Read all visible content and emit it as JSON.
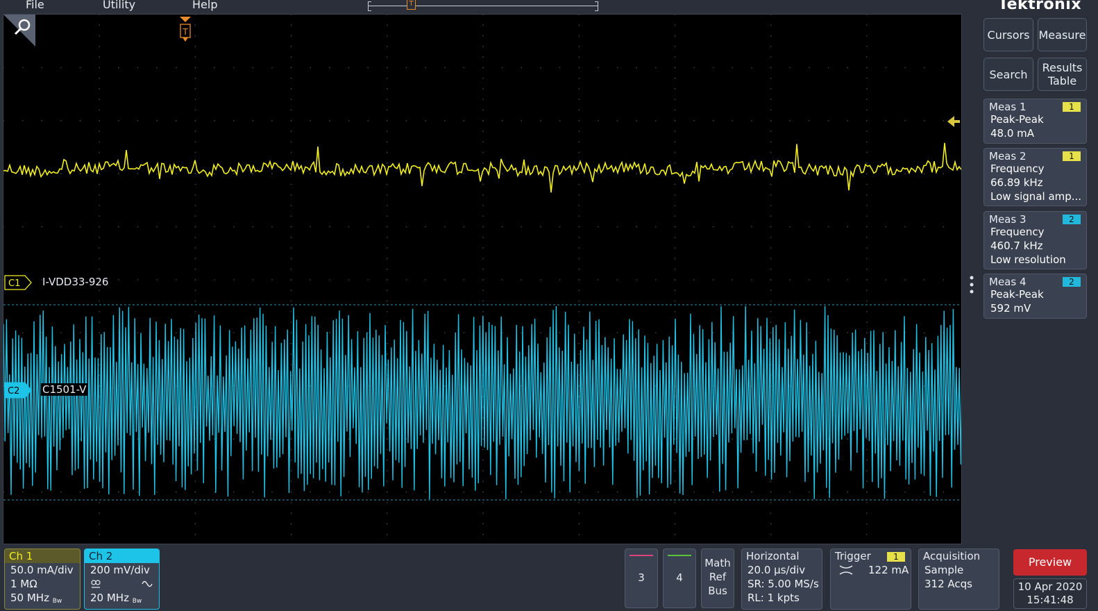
{
  "menu": {
    "file": "File",
    "utility": "Utility",
    "help": "Help"
  },
  "brand": "Tektronix",
  "timeline": {
    "trigger_glyph": "T"
  },
  "display": {
    "trigger_glyph": "T",
    "ch1_tag": "C1",
    "ch1_name": "I-VDD33-926",
    "ch2_tag": "C2",
    "ch2_name": "C1501-V",
    "ch1_color": "#f2ee22",
    "ch2_color": "#1ec4e8"
  },
  "side_buttons": {
    "cursors": "Cursors",
    "measure": "Measure",
    "search": "Search",
    "results_table": [
      "Results",
      "Table"
    ]
  },
  "measurements": [
    {
      "title": "Meas 1",
      "badge": "1",
      "lines": [
        "Peak-Peak",
        "48.0 mA"
      ]
    },
    {
      "title": "Meas 2",
      "badge": "1",
      "lines": [
        "Frequency",
        "66.89 kHz",
        "Low signal amp..."
      ]
    },
    {
      "title": "Meas 3",
      "badge": "2",
      "lines": [
        "Frequency",
        "460.7 kHz",
        "Low resolution"
      ]
    },
    {
      "title": "Meas 4",
      "badge": "2",
      "lines": [
        "Peak-Peak",
        "592 mV"
      ]
    }
  ],
  "channels": {
    "ch1": {
      "title": "Ch 1",
      "scale": "50.0 mA/div",
      "impedance": "1 MΩ",
      "bandwidth": "50 MHz",
      "bw_glyph": "Bw"
    },
    "ch2": {
      "title": "Ch 2",
      "scale": "200 mV/div",
      "bandwidth": "20 MHz",
      "bw_glyph": "Bw"
    }
  },
  "slots": {
    "ch3": "3",
    "ch4": "4"
  },
  "math_ref_bus": [
    "Math",
    "Ref",
    "Bus"
  ],
  "horizontal": {
    "title": "Horizontal",
    "scale": "20.0 µs/div",
    "sr": "SR: 5.00 MS/s",
    "rl": "RL: 1 kpts"
  },
  "trigger": {
    "title": "Trigger",
    "badge": "1",
    "level": "122 mA"
  },
  "acquisition": {
    "title": "Acquisition",
    "mode": "Sample",
    "acqs": "312 Acqs"
  },
  "preview": "Preview",
  "datetime": {
    "date": "10 Apr 2020",
    "time": "15:41:48"
  }
}
